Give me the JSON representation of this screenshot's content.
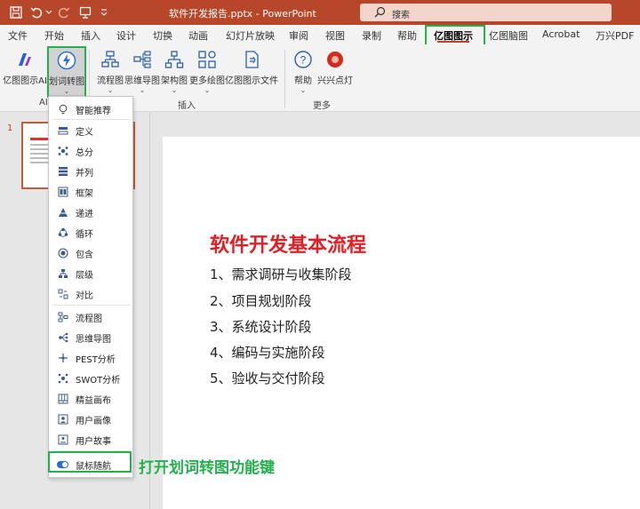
{
  "titlebar": {
    "title": "软件开发报告.pptx  -  PowerPoint",
    "search_placeholder": "搜索"
  },
  "tabs": [
    "文件",
    "开始",
    "插入",
    "设计",
    "切换",
    "动画",
    "幻灯片放映",
    "审阅",
    "视图",
    "录制",
    "帮助",
    "亿图图示",
    "亿图脑图",
    "Acrobat",
    "万兴PDF"
  ],
  "active_tab": "亿图图示",
  "ribbon": {
    "ai_group": {
      "label": "AI",
      "btn_ai": "亿图图示AI",
      "btn_convert": "划词转图"
    },
    "insert_group": {
      "label": "插入",
      "btn_flow": "流程图",
      "btn_mind": "思维导图",
      "btn_org": "架构图",
      "btn_more": "更多绘图",
      "btn_file": "亿图图示文件"
    },
    "more_group": {
      "label": "更多",
      "btn_help": "帮助",
      "btn_xingxing": "兴兴点灯"
    }
  },
  "slide_panel": {
    "slide_number": "1"
  },
  "slide": {
    "title": "软件开发基本流程",
    "items": [
      "1、需求调研与收集阶段",
      "2、项目规划阶段",
      "3、系统设计阶段",
      "4、编码与实施阶段",
      "5、验收与交付阶段"
    ]
  },
  "dropdown": {
    "items": [
      {
        "label": "智能推荐",
        "icon": "bulb-icon"
      },
      {
        "label": "定义",
        "icon": "define-icon"
      },
      {
        "label": "总分",
        "icon": "total-sub-icon"
      },
      {
        "label": "并列",
        "icon": "parallel-icon"
      },
      {
        "label": "框架",
        "icon": "framework-icon"
      },
      {
        "label": "递进",
        "icon": "progression-icon"
      },
      {
        "label": "循环",
        "icon": "cycle-icon"
      },
      {
        "label": "包含",
        "icon": "contain-icon"
      },
      {
        "label": "层级",
        "icon": "hierarchy-icon"
      },
      {
        "label": "对比",
        "icon": "compare-icon"
      },
      {
        "label": "流程图",
        "icon": "flowchart-icon"
      },
      {
        "label": "思维导图",
        "icon": "mindmap-icon"
      },
      {
        "label": "PEST分析",
        "icon": "pest-icon"
      },
      {
        "label": "SWOT分析",
        "icon": "swot-icon"
      },
      {
        "label": "精益画布",
        "icon": "lean-canvas-icon"
      },
      {
        "label": "用户画像",
        "icon": "persona-icon"
      },
      {
        "label": "用户故事",
        "icon": "user-story-icon"
      },
      {
        "label": "鼠标随航",
        "icon": "toggle-icon"
      }
    ]
  },
  "annotation": "打开划词转图功能键",
  "colors": {
    "accent": "#b7472a",
    "highlight_box": "#22b14c",
    "slide_title": "#e31e24",
    "toggle_on": "#2b6fd6"
  }
}
